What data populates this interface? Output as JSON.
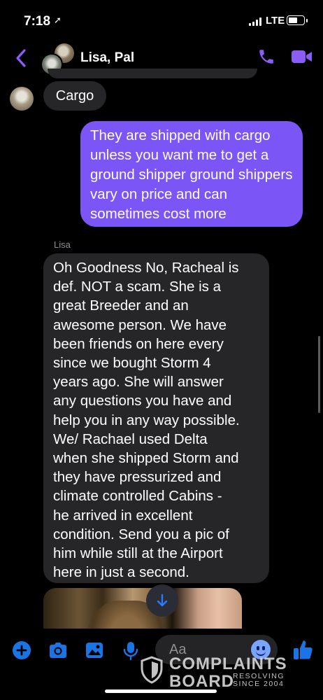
{
  "status_bar": {
    "time": "7:18",
    "network": "LTE"
  },
  "header": {
    "title": "Lisa, Pal"
  },
  "messages": {
    "cargo": "Cargo",
    "outgoing": "They are shipped with cargo unless you want me to get a ground shipper ground shippers vary on price and can sometimes cost more",
    "sender_name": "Lisa",
    "lisa_lines": [
      "Oh Goodness No, Racheal is",
      "def. NOT a scam. She is a",
      "great Breeder and an",
      "awesome person. We have",
      "been friends on here every",
      "since we bought Storm 4",
      "years ago. She will answer",
      "any questions you have and",
      "help you in any way possible.",
      "We/ Rachael used Delta",
      "when she shipped Storm and",
      "they have pressurized and",
      "climate controlled Cabins -",
      "he arrived in excellent",
      "condition. Send you a pic of",
      "him while still at the Airport",
      "here in just a second."
    ]
  },
  "composer": {
    "placeholder": "Aa"
  },
  "watermark": {
    "line1": "COMPLAINTS",
    "line2": "BOARD",
    "tag1": "RESOLVING",
    "tag2": "SINCE 2004"
  },
  "colors": {
    "accent": "#7c55f6",
    "icon_blue": "#1b74e4",
    "header_purple": "#8b5cf6",
    "bubble_gray": "#262628"
  }
}
